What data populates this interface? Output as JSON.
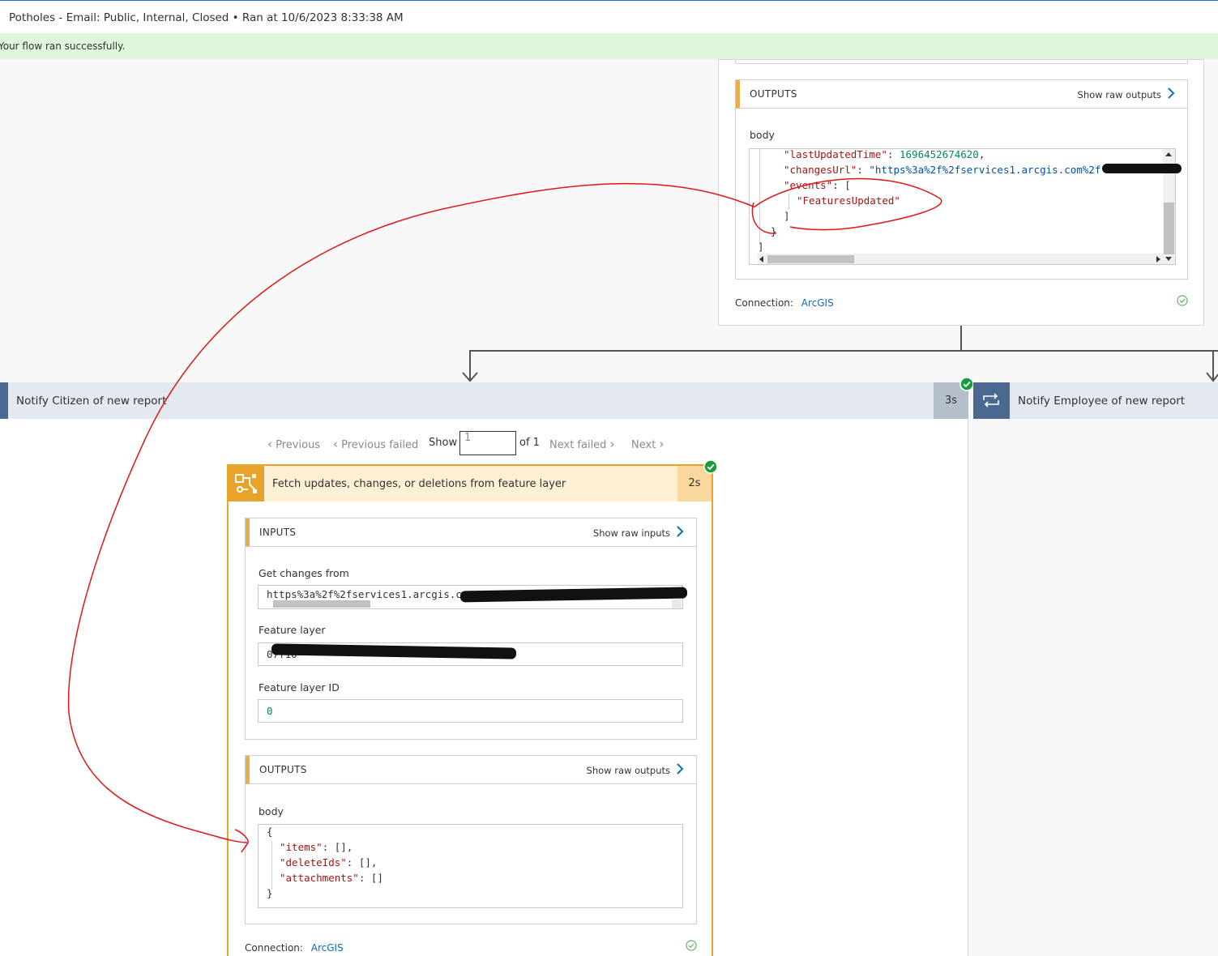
{
  "header": {
    "title": "Potholes - Email: Public, Internal, Closed • Ran at 10/6/2023 8:33:38 AM",
    "status": "Your flow ran successfully."
  },
  "top_action": {
    "outputs_label": "OUTPUTS",
    "show_raw_outputs": "Show raw outputs",
    "body_label": "body",
    "code_lines": [
      {
        "key": "\"lastUpdatedTime\"",
        "sep": ": ",
        "val": "1696452674620",
        "tail": ","
      },
      {
        "key": "\"changesUrl\"",
        "sep": ": ",
        "val": "\"https%3a%2f%2fservices1.arcgis.com%2f",
        "tail": ""
      },
      {
        "key": "\"events\"",
        "sep": ": ",
        "val": "[",
        "tail": ""
      },
      {
        "key": "",
        "sep": "",
        "val": "\"FeaturesUpdated\"",
        "tail": ""
      },
      {
        "key": "",
        "sep": "",
        "val": "]",
        "tail": ""
      },
      {
        "key": "",
        "sep": "",
        "val": "}",
        "tail": ""
      },
      {
        "key": "",
        "sep": "",
        "val": "]",
        "tail": ""
      }
    ],
    "connection_label": "Connection:",
    "connection_value": "ArcGIS"
  },
  "branches": {
    "left_title": "Notify Citizen of new report",
    "left_duration": "3s",
    "right_title": "Notify Employee of new report"
  },
  "pager": {
    "previous": "Previous",
    "previous_failed": "Previous failed",
    "show": "Show",
    "current": "1",
    "of": "of 1",
    "next_failed": "Next failed",
    "next": "Next"
  },
  "fetch_action": {
    "title": "Fetch updates, changes, or deletions from feature layer",
    "duration": "2s",
    "inputs_label": "INPUTS",
    "show_raw_inputs": "Show raw inputs",
    "get_changes_label": "Get changes from",
    "get_changes_value": "https%3a%2f%2fservices1.arcgis.co",
    "feature_layer_label": "Feature layer",
    "feature_layer_value": "07f10",
    "feature_layer_id_label": "Feature layer ID",
    "feature_layer_id_value": "0",
    "outputs_label": "OUTPUTS",
    "show_raw_outputs": "Show raw outputs",
    "body_label": "body",
    "body_lines": [
      {
        "key": "",
        "val": "{",
        "tail": ""
      },
      {
        "key": "\"items\"",
        "val": ": [],",
        "tail": ""
      },
      {
        "key": "\"deleteIds\"",
        "val": ": [],",
        "tail": ""
      },
      {
        "key": "\"attachments\"",
        "val": ": []",
        "tail": ""
      },
      {
        "key": "",
        "val": "}",
        "tail": ""
      }
    ],
    "connection_label": "Connection:",
    "connection_value": "ArcGIS"
  },
  "colors": {
    "accent_orange": "#e8a32a",
    "success_green": "#107c10",
    "link_blue": "#0f6cbd",
    "branch_bar": "#e4e8f0",
    "annotation_red": "#e01818"
  }
}
